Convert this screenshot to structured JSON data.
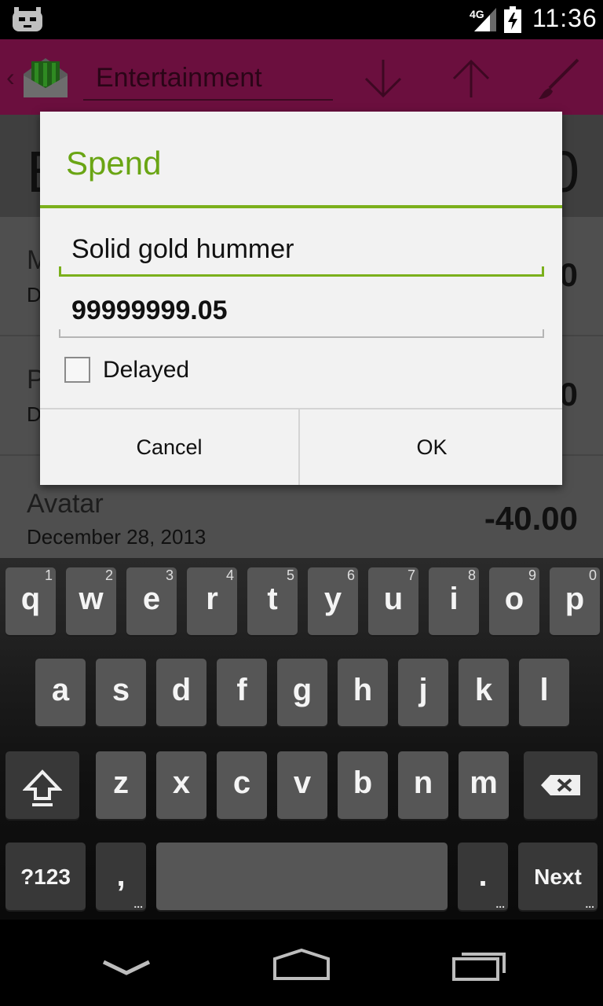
{
  "status_bar": {
    "network_label": "4G",
    "time": "11:36"
  },
  "action_bar": {
    "back_icon": "chevron-left-icon",
    "app_icon": "envelope-money-icon",
    "category": "Entertainment",
    "icons": [
      "arrow-down-icon",
      "arrow-up-icon",
      "brush-icon"
    ]
  },
  "background": {
    "header_left": "B",
    "header_right": "0",
    "rows": [
      {
        "title": "M",
        "date": "D",
        "amount": "0"
      },
      {
        "title": "P",
        "date": "D",
        "amount": "0"
      },
      {
        "title": "Avatar",
        "date": "December 28, 2013",
        "amount": "-40.00"
      }
    ]
  },
  "dialog": {
    "title": "Spend",
    "description_value": "Solid gold hummer",
    "amount_value": "99999999.05",
    "delayed_label": "Delayed",
    "delayed_checked": false,
    "cancel_label": "Cancel",
    "ok_label": "OK",
    "accent_color": "#6aa514"
  },
  "keyboard": {
    "row1": [
      {
        "label": "q",
        "hint": "1"
      },
      {
        "label": "w",
        "hint": "2"
      },
      {
        "label": "e",
        "hint": "3"
      },
      {
        "label": "r",
        "hint": "4"
      },
      {
        "label": "t",
        "hint": "5"
      },
      {
        "label": "y",
        "hint": "6"
      },
      {
        "label": "u",
        "hint": "7"
      },
      {
        "label": "i",
        "hint": "8"
      },
      {
        "label": "o",
        "hint": "9"
      },
      {
        "label": "p",
        "hint": "0"
      }
    ],
    "row2": [
      "a",
      "s",
      "d",
      "f",
      "g",
      "h",
      "j",
      "k",
      "l"
    ],
    "row3": [
      "z",
      "x",
      "c",
      "v",
      "b",
      "n",
      "m"
    ],
    "symbols_label": "?123",
    "comma_label": ",",
    "period_label": ".",
    "next_label": "Next",
    "more_dots": "..."
  },
  "nav_bar": {
    "icons": [
      "back-chevron-icon",
      "home-icon",
      "recents-icon"
    ]
  }
}
